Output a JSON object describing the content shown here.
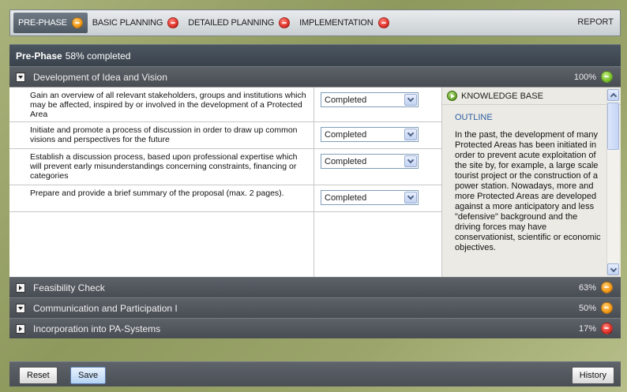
{
  "phases": [
    {
      "label": "PRE-PHASE",
      "status": "orange"
    },
    {
      "label": "BASIC PLANNING",
      "status": "red"
    },
    {
      "label": "DETAILED PLANNING",
      "status": "red"
    },
    {
      "label": "IMPLEMENTATION",
      "status": "red"
    }
  ],
  "report_label": "REPORT",
  "section": {
    "title": "Pre-Phase",
    "progress_text": "58% completed"
  },
  "accordion": [
    {
      "label": "Development of Idea and Vision",
      "percent": "100%",
      "status": "green",
      "expanded": true
    },
    {
      "label": "Feasibility Check",
      "percent": "63%",
      "status": "orange",
      "expanded": false
    },
    {
      "label": "Communication and Participation I",
      "percent": "50%",
      "status": "orange",
      "expanded": true
    },
    {
      "label": "Incorporation into PA-Systems",
      "percent": "17%",
      "status": "red",
      "expanded": false
    }
  ],
  "tasks": [
    {
      "text": "Gain an overview of all relevant stakeholders, groups and institutions which may be affected, inspired by or involved in the development of a Protected Area",
      "status": "Completed"
    },
    {
      "text": "Initiate and promote a process of discussion in order to draw up common visions and perspectives for the future",
      "status": "Completed"
    },
    {
      "text": "Establish a discussion process, based upon professional expertise which will prevent early misunderstandings concerning constraints, financing or categories",
      "status": "Completed"
    },
    {
      "text": "Prepare and provide a brief summary of the proposal (max. 2 pages).",
      "status": "Completed"
    }
  ],
  "knowledge_base": {
    "title": "KNOWLEDGE BASE",
    "outline": "OUTLINE",
    "text": "In the past, the development of many Protected Areas has been initiated in order to prevent acute exploitation of the site by, for example, a large scale tourist project or the construction of a power station. Nowadays, more and more Protected Areas are developed against a more anticipatory and less \"defensive\" background and the driving forces may have conservationist, scientific or economic objectives."
  },
  "footer": {
    "reset_label": "Reset",
    "save_label": "Save",
    "history_label": "History"
  },
  "colors": {
    "orange": "#f39a18",
    "red": "#e0332a",
    "green": "#7cc22e"
  }
}
